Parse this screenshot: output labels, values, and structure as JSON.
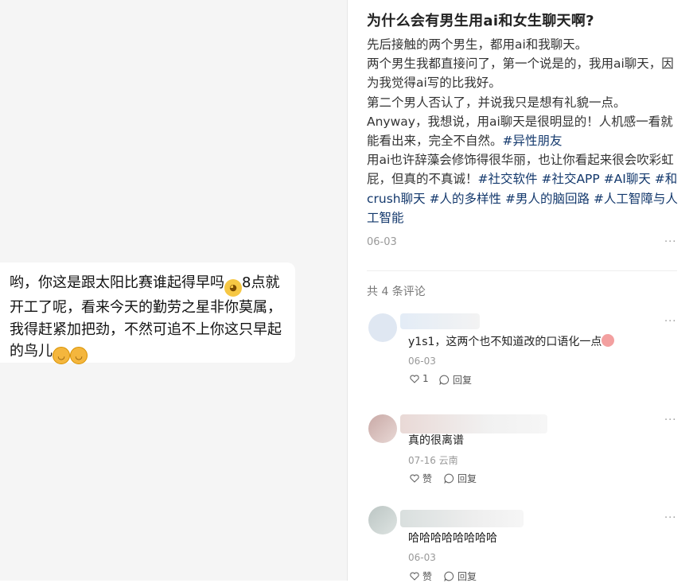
{
  "chat": {
    "message_part1": "哟，你这是跟太阳比赛谁起得早吗",
    "message_part2": "8点就开工了呢，看来今天的勤劳之星非你莫属，我得赶紧加把劲，不然可追不上你这只早起的鸟儿"
  },
  "post": {
    "title": "为什么会有男生用ai和女生聊天啊?",
    "lines": [
      "先后接触的两个男生，都用ai和我聊天。",
      "两个男生我都直接问了，第一个说是的，我用ai聊天，因为我觉得ai写的比我好。",
      "第二个男人否认了，并说我只是想有礼貌一点。",
      "Anyway，我想说，用ai聊天是很明显的！人机感一看就能看出来，完全不自然。"
    ],
    "tag_line4": "#异性朋友",
    "last_line": "用ai也许辞藻会修饰得很华丽，也让你看起来很会吹彩虹屁，但真的不真诚！",
    "tags": [
      "#社交软件",
      "#社交APP",
      "#AI聊天",
      "#和crush聊天",
      "#人的多样性",
      "#男人的脑回路",
      "#人工智障与人工智能"
    ],
    "date": "06-03",
    "more": "···"
  },
  "comments": {
    "count_label": "共 4 条评论",
    "items": [
      {
        "text": "y1s1，这两个也不知道改的口语化一点",
        "date": "06-03",
        "like_label": "1",
        "reply_label": "回复"
      },
      {
        "text": "真的很离谱",
        "date": "07-16 云南",
        "like_label": "赞",
        "reply_label": "回复"
      },
      {
        "text": "哈哈哈哈哈哈哈哈",
        "date": "06-03",
        "like_label": "赞",
        "reply_label": "回复"
      }
    ]
  },
  "colors": {
    "tag": "#13386c",
    "left_bg": "#f5f5f5",
    "meta": "#999999"
  }
}
